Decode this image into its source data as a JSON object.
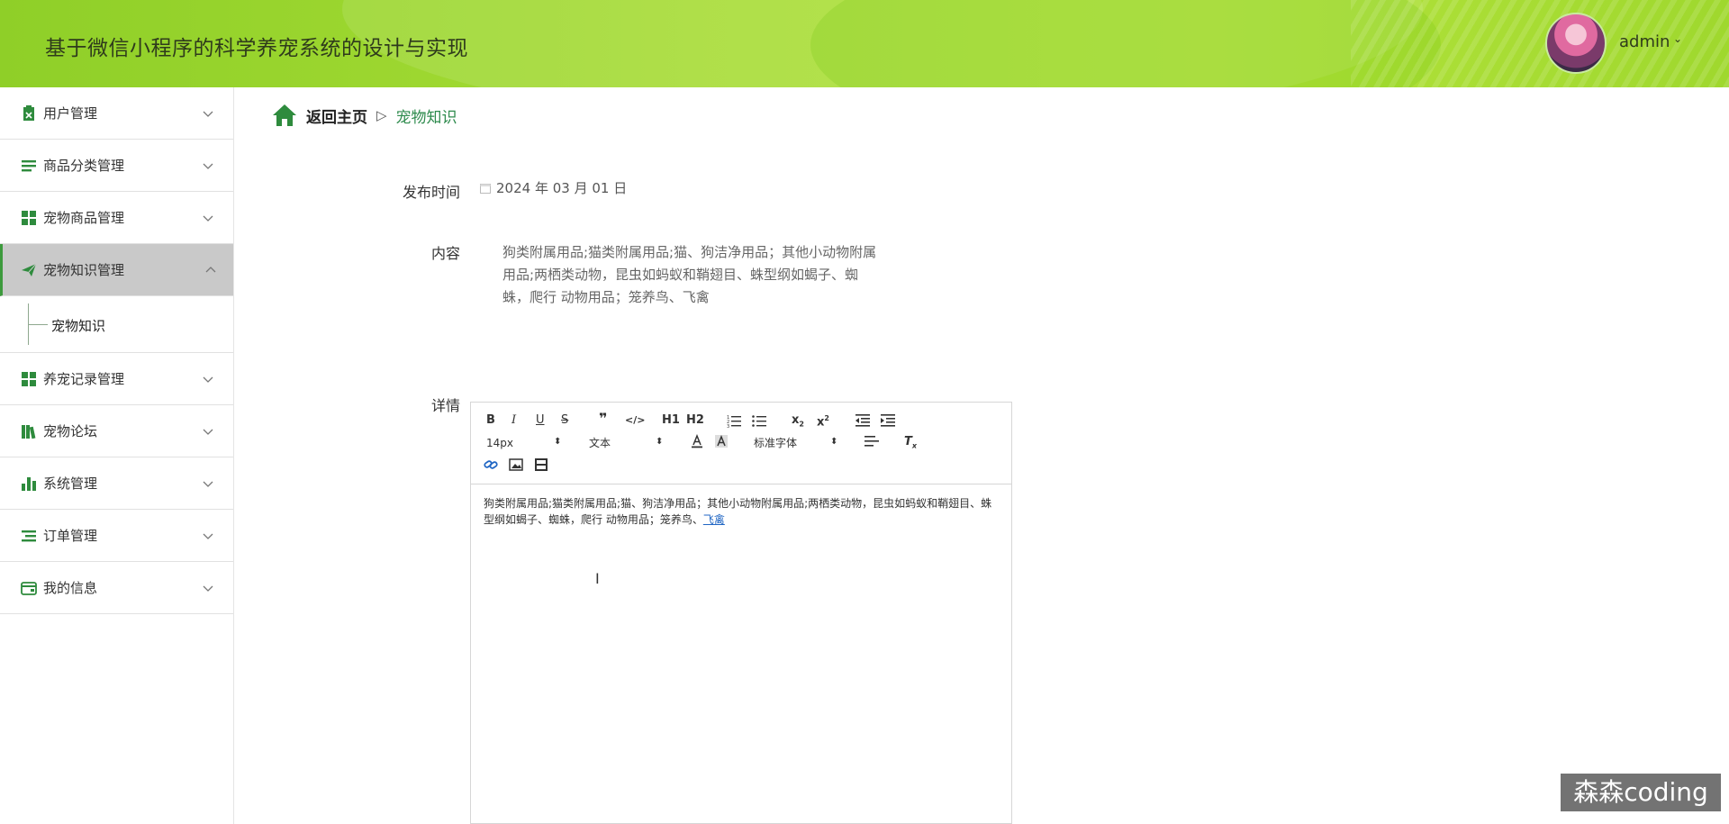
{
  "header": {
    "title": "基于微信小程序的科学养宠系统的设计与实现",
    "user_name": "admin",
    "user_caret": "⌄"
  },
  "sidebar": {
    "items": [
      {
        "label": "用户管理",
        "icon": "user-badge-icon"
      },
      {
        "label": "商品分类管理",
        "icon": "list-icon"
      },
      {
        "label": "宠物商品管理",
        "icon": "grid-icon"
      },
      {
        "label": "宠物知识管理",
        "icon": "paper-plane-icon",
        "expanded": true
      },
      {
        "label": "养宠记录管理",
        "icon": "grid-icon"
      },
      {
        "label": "宠物论坛",
        "icon": "books-icon"
      },
      {
        "label": "系统管理",
        "icon": "bar-chart-icon"
      },
      {
        "label": "订单管理",
        "icon": "list-icon"
      },
      {
        "label": "我的信息",
        "icon": "wallet-icon"
      }
    ],
    "submenu": {
      "label": "宠物知识"
    }
  },
  "breadcrumb": {
    "home": "返回主页",
    "separator": "▷",
    "current": "宠物知识"
  },
  "form": {
    "publish_time_label": "发布时间",
    "publish_time_value": "2024 年 03 月 01 日",
    "content_label": "内容",
    "content_value": "狗类附属用品;猫类附属用品;猫、狗洁净用品；其他小动物附属用品;两栖类动物，昆虫如蚂蚁和鞘翅目、蛛型纲如蝎子、蜘蛛，爬行 动物用品；笼养鸟、飞禽",
    "detail_label": "详情"
  },
  "editor": {
    "font_size": "14px",
    "block_format": "文本",
    "font_family": "标准字体",
    "h1": "H1",
    "h2": "H2",
    "body_text": "狗类附属用品;猫类附属用品;猫、狗洁净用品；其他小动物附属用品;两栖类动物，昆虫如蚂蚁和鞘翅目、蛛型纲如蝎子、蜘蛛，爬行 动物用品；笼养鸟、",
    "body_link": "飞禽"
  },
  "watermark": "森森coding",
  "colors": {
    "header_green": "#a6dc35",
    "accent_green": "#2e8b3d",
    "active_menu_bg": "#c9c9c9"
  }
}
